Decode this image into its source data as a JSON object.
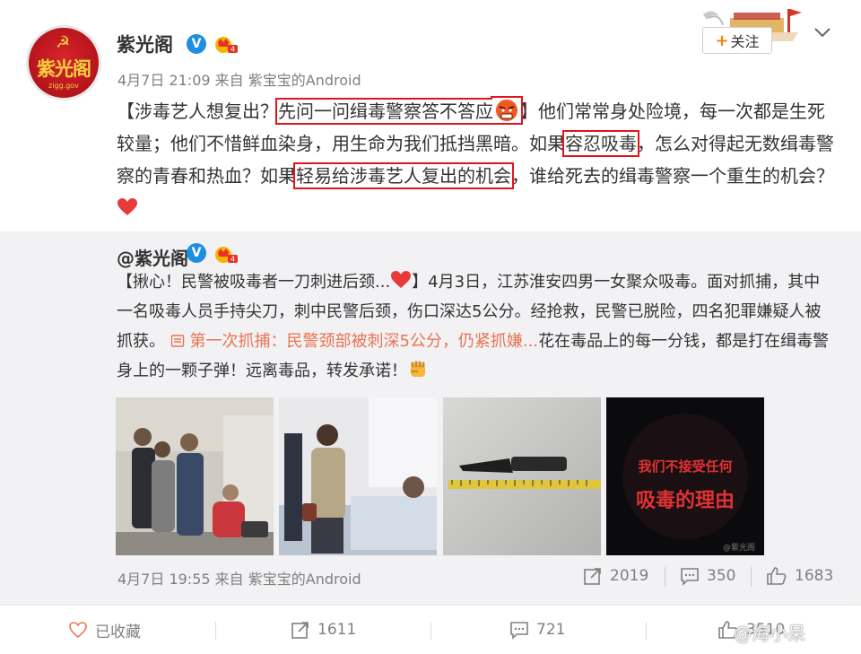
{
  "header": {
    "username": "紫光阁",
    "avatar_text": "紫光阁",
    "avatar_subtext": "zigg.gov",
    "time": "4月7日 21:09",
    "via_prefix": "来自",
    "source": "紫宝宝的Android",
    "follow_label": "关注"
  },
  "post": {
    "seg1": "【涉毒艺人想复出？",
    "hl1": "先问一问缉毒警察答不答应",
    "seg2": "】他们常常身处险境，每一次都是生死较量；他们不惜鲜血染身，用生命为我们抵挡黑暗。如果",
    "hl2": "容忍吸毒",
    "seg3": "，怎么对得起无数缉毒警察的青春和热血？如果",
    "hl3": "轻易给涉毒艺人复出的机会",
    "seg4": "，谁给死去的缉毒警察一个重生的机会？",
    "highlight_color": "#e1141c"
  },
  "repost": {
    "username": "@紫光阁",
    "seg1": "【揪心！民警被吸毒者一刀刺进后颈...",
    "seg2": "】4月3日，江苏淮安四男一女聚众吸毒。面对抓捕，其中一名吸毒人员手持尖刀，刺中民警后颈，伤口深达5公分。经抢救，民警已脱险，四名犯罪嫌疑人被抓获。",
    "link_text": " 第一次抓捕：民警颈部被刺深5公分，仍紧抓嫌...",
    "seg3": "花在毒品上的每一分钱，都是打在缉毒警身上的一颗子弹！远离毒品，转发承诺！",
    "link_color": "#eb7350",
    "image4_line1": "我们不接受任何",
    "image4_line2": "吸毒的理由",
    "image_watermark": "@紫光阁",
    "time": "4月7日 19:55",
    "via_prefix": "来自",
    "source": "紫宝宝的Android",
    "reposts": "2019",
    "comments": "350",
    "likes": "1683"
  },
  "toolbar": {
    "favorite_label": "已收藏",
    "repost_count": "1611",
    "comment_count": "721",
    "like_count": "3510"
  },
  "watermark": "@海小呆",
  "icons": [
    "verified-v-icon",
    "member-crown-icon",
    "chevron-down-icon",
    "angry-face-icon",
    "heart-icon",
    "fist-icon",
    "link-icon",
    "repost-icon",
    "comment-icon",
    "like-icon",
    "favorite-icon"
  ],
  "colors": {
    "accent_orange": "#ff8200",
    "verified_blue": "#1d8fe1",
    "meta_gray": "#808080"
  }
}
